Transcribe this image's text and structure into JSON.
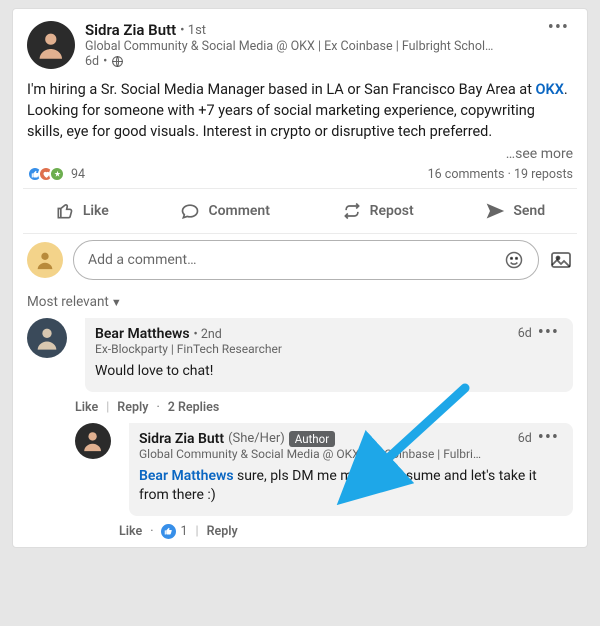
{
  "post": {
    "author": {
      "name": "Sidra Zia Butt",
      "degree": "1st",
      "headline": "Global Community & Social Media @ OKX | Ex Coinbase | Fulbright Schol…",
      "time": "6d",
      "visibility": "public"
    },
    "body_pre": "I'm hiring a Sr. Social Media Manager based in LA or San Francisco Bay Area at ",
    "body_link": "OKX",
    "body_post": ". Looking for someone with +7 years of social marketing experience, copywriting skills, eye for good visuals. Interest in crypto or disruptive tech preferred.",
    "see_more": "…see more",
    "stats": {
      "reactions_count": "94",
      "comments_label": "16 comments",
      "reposts_label": "19 reposts",
      "dot": "·"
    }
  },
  "actions": {
    "like": "Like",
    "comment": "Comment",
    "repost": "Repost",
    "send": "Send"
  },
  "compose": {
    "placeholder": "Add a comment…"
  },
  "sort": {
    "label": "Most relevant"
  },
  "comments": {
    "c1": {
      "name": "Bear Matthews",
      "degree": "2nd",
      "time": "6d",
      "headline": "Ex-Blockparty | FinTech Researcher",
      "text": "Would love to chat!",
      "actions": {
        "like": "Like",
        "reply": "Reply",
        "replies_count": "2 Replies"
      }
    },
    "c1r1": {
      "name": "Sidra Zia Butt",
      "pronouns": "(She/Her)",
      "author_badge": "Author",
      "time": "6d",
      "headline": "Global Community & Social Media @ OKX | Ex Coinbase | Fulbri…",
      "mention": "Bear Matthews",
      "text": " sure, pls DM me me your resume and let's take it from there :)",
      "actions": {
        "like": "Like",
        "like_count": "1",
        "reply": "Reply"
      }
    }
  }
}
